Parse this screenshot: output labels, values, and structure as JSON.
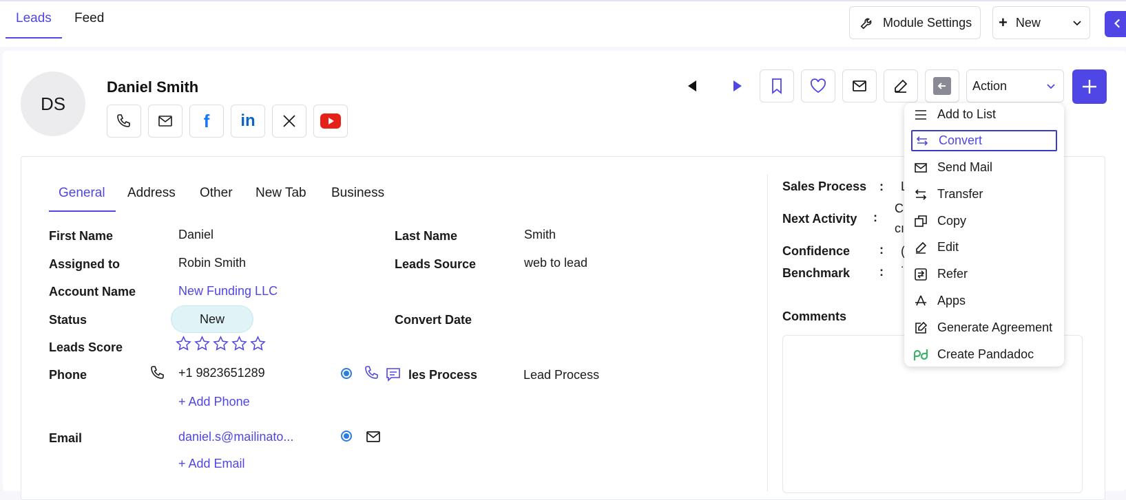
{
  "top_tabs": {
    "leads": "Leads",
    "feed": "Feed"
  },
  "toolbar": {
    "module_settings": "Module Settings",
    "new": "New"
  },
  "lead": {
    "initials": "DS",
    "name": "Daniel Smith"
  },
  "header_actions": {
    "action_label": "Action"
  },
  "subtabs": [
    "General",
    "Address",
    "Other",
    "New Tab",
    "Business"
  ],
  "fields": {
    "first_name_label": "First Name",
    "first_name": "Daniel",
    "last_name_label": "Last Name",
    "last_name": "Smith",
    "assigned_label": "Assigned to",
    "assigned": "Robin Smith",
    "leads_source_label": "Leads Source",
    "leads_source": "web to lead",
    "account_label": "Account Name",
    "account": "New Funding LLC",
    "status_label": "Status",
    "status": "New",
    "convert_date_label": "Convert Date",
    "score_label": "Leads Score",
    "phone_label": "Phone",
    "phone": "+1 9823651289",
    "add_phone": "+ Add Phone",
    "sales_process_partial_label": "les Process",
    "sales_process_value": "Lead Process",
    "email_label": "Email",
    "email": "daniel.s@mailinato...",
    "add_email": "+ Add Email"
  },
  "right_panel": {
    "sales_process_label": "Sales Process",
    "sales_process_value_partial": "L",
    "next_activity_label": "Next Activity",
    "next_activity_partial_1": "C",
    "next_activity_partial_2": "cı",
    "confidence_label": "Confidence",
    "confidence_partial": "(",
    "benchmark_label": "Benchmark",
    "benchmark_partial": "˙",
    "comments_label": "Comments",
    "colon": ":"
  },
  "leads_score": {
    "value": 0,
    "max": 5
  },
  "action_menu": {
    "items": [
      {
        "label": "Add to List",
        "icon": "list-icon"
      },
      {
        "label": "Convert",
        "icon": "convert-icon",
        "selected": true
      },
      {
        "label": "Send Mail",
        "icon": "mail-icon"
      },
      {
        "label": "Transfer",
        "icon": "transfer-icon"
      },
      {
        "label": "Copy",
        "icon": "copy-icon"
      },
      {
        "label": "Edit",
        "icon": "edit-icon"
      },
      {
        "label": "Refer",
        "icon": "refer-icon"
      },
      {
        "label": "Apps",
        "icon": "apps-icon"
      },
      {
        "label": "Generate Agreement",
        "icon": "agreement-icon"
      },
      {
        "label": "Create Pandadoc",
        "icon": "pandadoc-icon"
      }
    ]
  },
  "colors": {
    "accent": "#4f46e5",
    "status_bg": "#e0f4f8",
    "youtube": "#e62117",
    "linkedin": "#0a66c2",
    "facebook": "#1877f2",
    "pandadoc": "#3ab26a"
  }
}
